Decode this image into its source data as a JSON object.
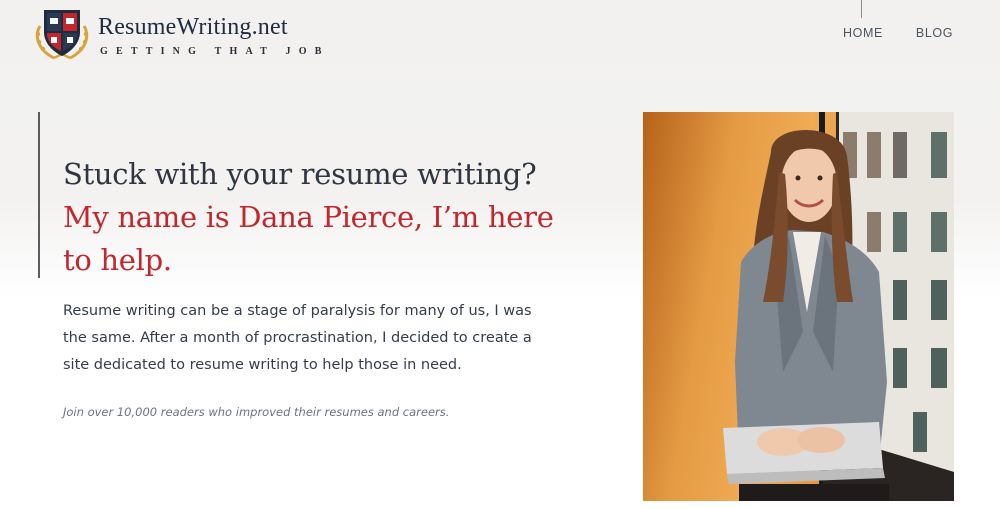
{
  "brand": {
    "title": "ResumeWriting.net",
    "tagline": "Getting that job",
    "emblem_icon": "shield-crest-icon",
    "colors": {
      "navy": "#1f2b3e",
      "red": "#c1272d",
      "gold": "#d8a33a"
    }
  },
  "nav": {
    "items": [
      {
        "label": "HOME"
      },
      {
        "label": "BLOG"
      }
    ]
  },
  "hero": {
    "headline": "Stuck with your resume writing?",
    "headline_highlight": "My name is Dana Pierce, I’m here to help.",
    "intro": "Resume writing can be a stage of paralysis for many of us, I was the same. After a month of procrastination, I decided to create a site dedicated to resume writing to help those in need.",
    "join_note": "Join over 10,000 readers who improved their resumes and careers.",
    "accent_color": "#c1272d"
  },
  "photo": {
    "subject_icon": "portrait-photo-icon"
  }
}
